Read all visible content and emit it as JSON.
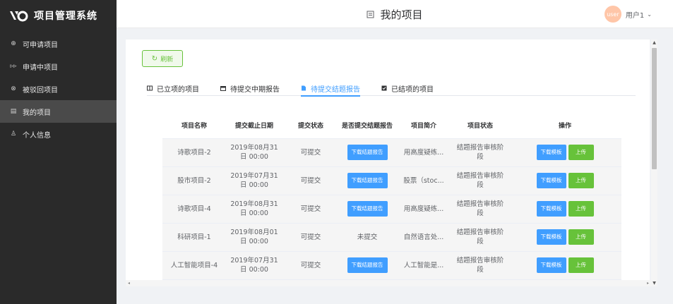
{
  "app": {
    "logo_text": "项目管理系统"
  },
  "sidebar": {
    "items": [
      {
        "label": "可申请项目",
        "icon": "plus-circle-icon",
        "active": false
      },
      {
        "label": "申请中项目",
        "icon": "fast-forward-icon",
        "active": false
      },
      {
        "label": "被驳回项目",
        "icon": "close-circle-icon",
        "active": false
      },
      {
        "label": "我的项目",
        "icon": "document-icon",
        "active": true
      },
      {
        "label": "个人信息",
        "icon": "person-icon",
        "active": false
      }
    ]
  },
  "header": {
    "title": "我的项目",
    "avatar_text": "user",
    "user_name": "用户1",
    "caret": "⌄"
  },
  "toolbar": {
    "refresh_label": "刷新"
  },
  "tabs": [
    {
      "label": "已立项的项目",
      "icon": "book-icon",
      "active": false
    },
    {
      "label": "待提交中期报告",
      "icon": "calendar-icon",
      "active": false
    },
    {
      "label": "待提交结题报告",
      "icon": "file-icon",
      "active": true
    },
    {
      "label": "已结项的项目",
      "icon": "checkbox-icon",
      "active": false
    }
  ],
  "table": {
    "headers": [
      "项目名称",
      "提交截止日期",
      "提交状态",
      "是否提交结题报告",
      "项目简介",
      "项目状态",
      "操作"
    ],
    "rows": [
      {
        "name": "诗歌项目-2",
        "deadline": "2019年08月31日 00:00",
        "status": "可提交",
        "report": "下载结题报告",
        "report_is_button": true,
        "intro": "用高度疑练...",
        "state": "结题报告审核阶段"
      },
      {
        "name": "股市项目-2",
        "deadline": "2019年07月31日 00:00",
        "status": "可提交",
        "report": "下载结题报告",
        "report_is_button": true,
        "intro": "股票（stoc...",
        "state": "结题报告审核阶段"
      },
      {
        "name": "诗歌项目-4",
        "deadline": "2019年08月31日 00:00",
        "status": "可提交",
        "report": "下载结题报告",
        "report_is_button": true,
        "intro": "用高度疑练...",
        "state": "结题报告审核阶段"
      },
      {
        "name": "科研项目-1",
        "deadline": "2019年08月01日 00:00",
        "status": "可提交",
        "report": "未提交",
        "report_is_button": false,
        "intro": "自然语言处...",
        "state": "结题报告审核阶段"
      },
      {
        "name": "人工智能项目-4",
        "deadline": "2019年07月31日 00:00",
        "status": "可提交",
        "report": "下载结题报告",
        "report_is_button": true,
        "intro": "人工智能是...",
        "state": "结题报告审核阶段"
      }
    ],
    "actions": {
      "download_template": "下载模板",
      "upload": "上传"
    }
  }
}
